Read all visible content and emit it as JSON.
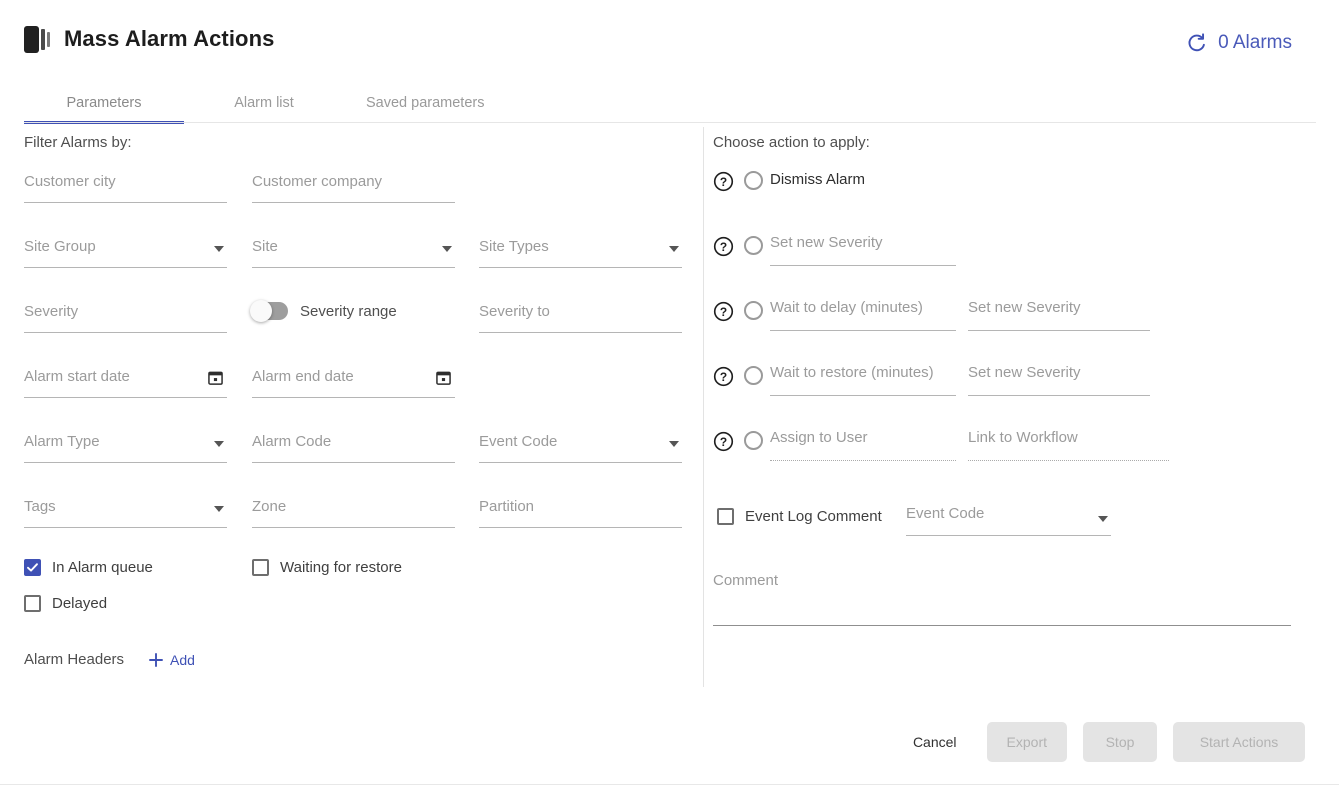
{
  "header": {
    "icon": "app-collection-icon",
    "title": "Mass Alarm Actions",
    "refresh_icon": "refresh-icon",
    "alarm_count": "0 Alarms",
    "accent_color": "#3f51b5"
  },
  "tabs": [
    {
      "label": "Parameters",
      "active": true
    },
    {
      "label": "Alarm list",
      "active": false
    },
    {
      "label": "Saved parameters",
      "active": false
    }
  ],
  "filters": {
    "section_title": "Filter Alarms by:",
    "fields": [
      {
        "placeholder": "Customer city",
        "value": "",
        "type": "text",
        "col": 1,
        "row": 1
      },
      {
        "placeholder": "Customer company",
        "value": "",
        "type": "text",
        "col": 2,
        "row": 1
      },
      {
        "placeholder": "Site Group",
        "value": "",
        "type": "select",
        "col": 1,
        "row": 2
      },
      {
        "placeholder": "Site",
        "value": "",
        "type": "select",
        "col": 2,
        "row": 2
      },
      {
        "placeholder": "Site Types",
        "value": "",
        "type": "select",
        "col": 3,
        "row": 2
      },
      {
        "placeholder": "Severity",
        "value": "",
        "type": "text",
        "col": 1,
        "row": 3
      },
      {
        "placeholder": "Severity to",
        "value": "",
        "type": "text",
        "col": 3,
        "row": 3
      },
      {
        "placeholder": "Alarm start date",
        "value": "",
        "type": "date",
        "col": 1,
        "row": 4
      },
      {
        "placeholder": "Alarm end date",
        "value": "",
        "type": "date",
        "col": 2,
        "row": 4
      },
      {
        "placeholder": "Alarm Type",
        "value": "",
        "type": "select",
        "col": 1,
        "row": 5
      },
      {
        "placeholder": "Alarm Code",
        "value": "",
        "type": "text",
        "col": 2,
        "row": 5
      },
      {
        "placeholder": "Event Code",
        "value": "",
        "type": "select",
        "col": 3,
        "row": 5
      },
      {
        "placeholder": "Tags",
        "value": "",
        "type": "select",
        "col": 1,
        "row": 6
      },
      {
        "placeholder": "Zone",
        "value": "",
        "type": "text",
        "col": 2,
        "row": 6
      },
      {
        "placeholder": "Partition",
        "value": "",
        "type": "text",
        "col": 3,
        "row": 6
      }
    ],
    "severity_range_toggle": {
      "label": "Severity range",
      "on": false
    },
    "checkboxes": [
      {
        "label": "In Alarm queue",
        "checked": true
      },
      {
        "label": "Waiting for restore",
        "checked": false
      },
      {
        "label": "Delayed",
        "checked": false
      }
    ],
    "alarm_headers": {
      "label": "Alarm Headers",
      "add_label": "Add",
      "add_icon": "plus-icon"
    }
  },
  "actions": {
    "section_title": "Choose action to apply:",
    "rows": [
      {
        "help_icon": "help-circle-icon",
        "selected": false,
        "label": "Dismiss Alarm",
        "field1": null,
        "field2": null
      },
      {
        "help_icon": "help-circle-icon",
        "selected": false,
        "label": null,
        "field1": {
          "placeholder": "Set new Severity",
          "value": "",
          "style": "solid"
        },
        "field2": null
      },
      {
        "help_icon": "help-circle-icon",
        "selected": false,
        "label": null,
        "field1": {
          "placeholder": "Wait to delay (minutes)",
          "value": "",
          "style": "solid"
        },
        "field2": {
          "placeholder": "Set new Severity",
          "value": "",
          "style": "solid"
        }
      },
      {
        "help_icon": "help-circle-icon",
        "selected": false,
        "label": null,
        "field1": {
          "placeholder": "Wait to restore (minutes)",
          "value": "",
          "style": "solid"
        },
        "field2": {
          "placeholder": "Set new Severity",
          "value": "",
          "style": "solid"
        }
      },
      {
        "help_icon": "help-circle-icon",
        "selected": false,
        "label": null,
        "field1": {
          "placeholder": "Assign to User",
          "value": "",
          "style": "dotted"
        },
        "field2": {
          "placeholder": "Link to Workflow",
          "value": "",
          "style": "dotted"
        }
      }
    ],
    "event_log_comment": {
      "checkbox_label": "Event Log Comment",
      "checked": false,
      "event_code": {
        "placeholder": "Event Code",
        "value": "",
        "type": "select"
      }
    },
    "comment": {
      "placeholder": "Comment",
      "value": ""
    }
  },
  "footer": {
    "cancel_label": "Cancel",
    "export_label": "Export",
    "stop_label": "Stop",
    "start_label": "Start Actions"
  }
}
